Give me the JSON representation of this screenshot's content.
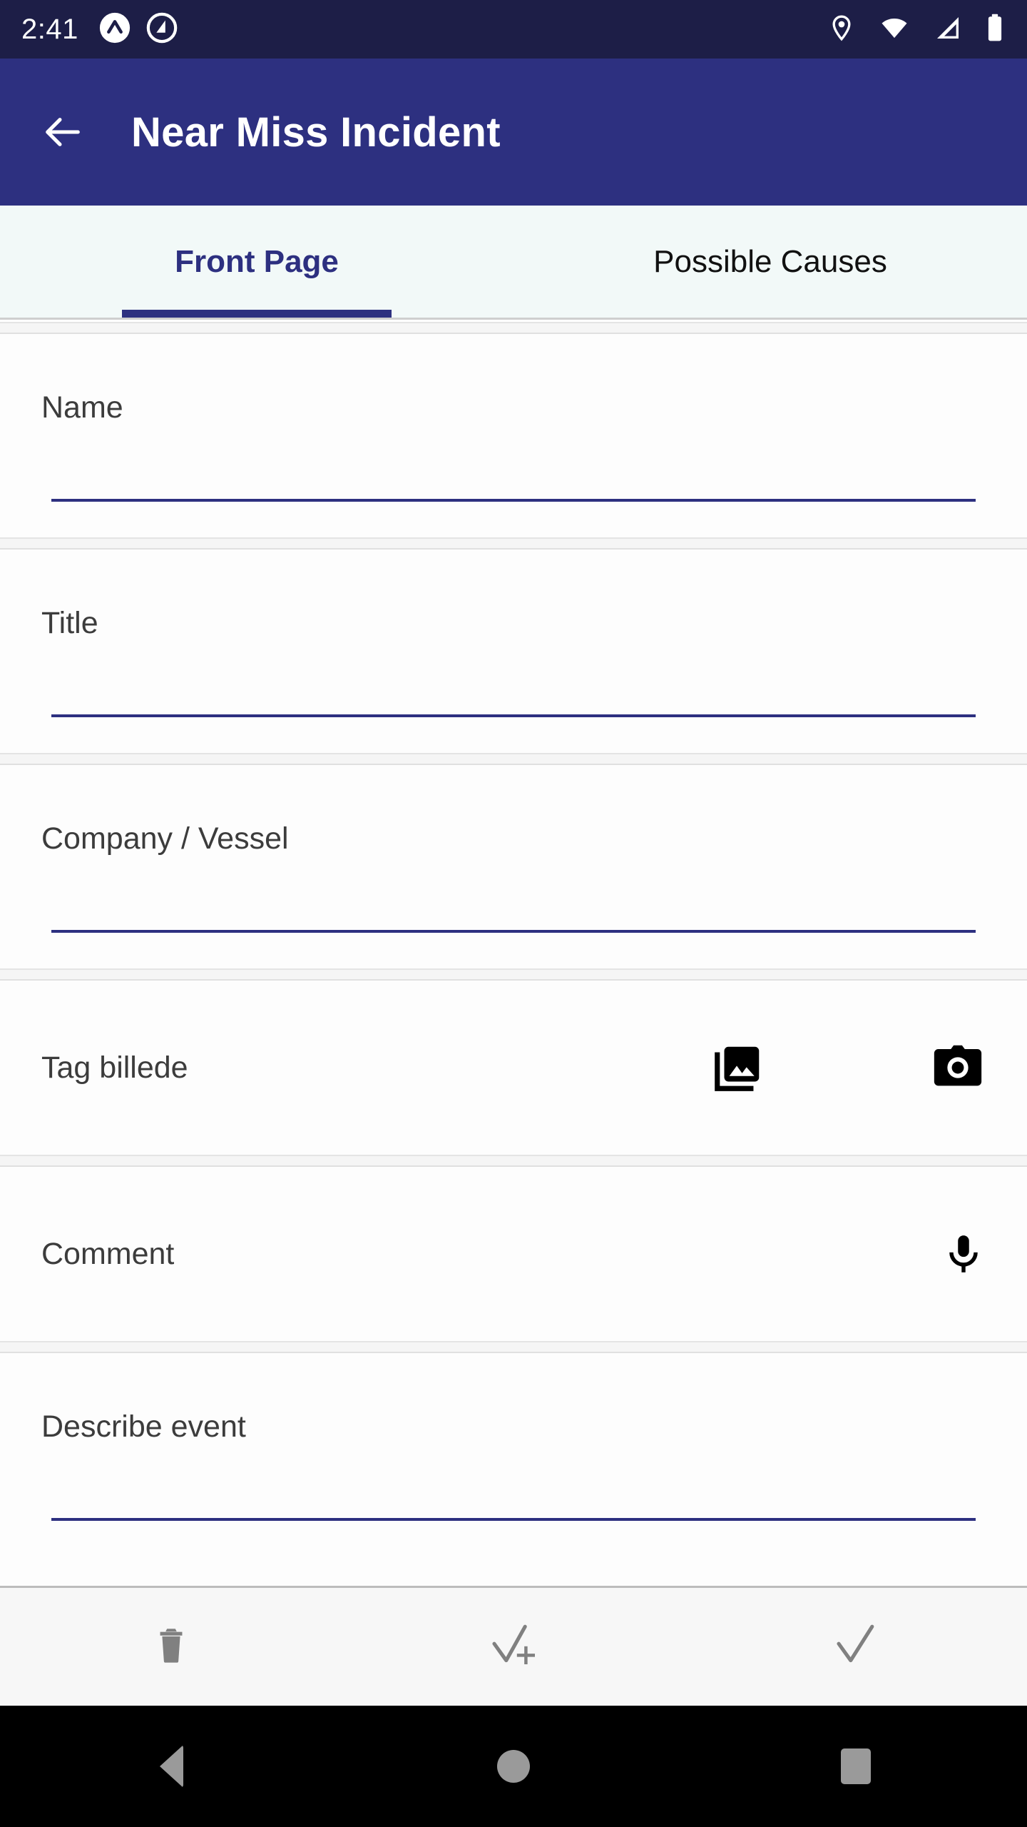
{
  "status_bar": {
    "time": "2:41",
    "notification_icons": [
      "app-logo-chevron-icon",
      "app-logo-circle-q-icon"
    ],
    "system_icons": [
      "location-icon",
      "wifi-icon",
      "cellular-signal-icon",
      "battery-icon"
    ],
    "background_color": "#1d1e47"
  },
  "app_bar": {
    "back_label": "back-arrow",
    "title": "Near Miss Incident",
    "background_color": "#2d3080"
  },
  "tabs": {
    "items": [
      {
        "label": "Front Page",
        "active": true
      },
      {
        "label": "Possible Causes",
        "active": false
      }
    ],
    "indicator_color": "#2d3080",
    "background_color": "#f2f9f8"
  },
  "form": {
    "fields": [
      {
        "label": "Name",
        "value": "",
        "type": "text-input"
      },
      {
        "label": "Title",
        "value": "",
        "type": "text-input"
      },
      {
        "label": "Company / Vessel",
        "value": "",
        "type": "text-input"
      },
      {
        "label": "Tag billede",
        "value": "",
        "type": "image-actions"
      },
      {
        "label": "Comment",
        "value": "",
        "type": "voice-action"
      },
      {
        "label": "Describe event",
        "value": "",
        "type": "text-input"
      }
    ],
    "underline_color": "#2d3080"
  },
  "bottom_toolbar": {
    "items": [
      {
        "name": "delete-button",
        "icon": "trash-icon"
      },
      {
        "name": "save-and-new-button",
        "icon": "check-plus-icon"
      },
      {
        "name": "save-button",
        "icon": "check-icon"
      }
    ],
    "icon_color": "#808080"
  },
  "nav_bar": {
    "items": [
      {
        "name": "android-back-button",
        "icon": "triangle-back-icon"
      },
      {
        "name": "android-home-button",
        "icon": "circle-home-icon"
      },
      {
        "name": "android-recents-button",
        "icon": "square-recents-icon"
      }
    ]
  }
}
